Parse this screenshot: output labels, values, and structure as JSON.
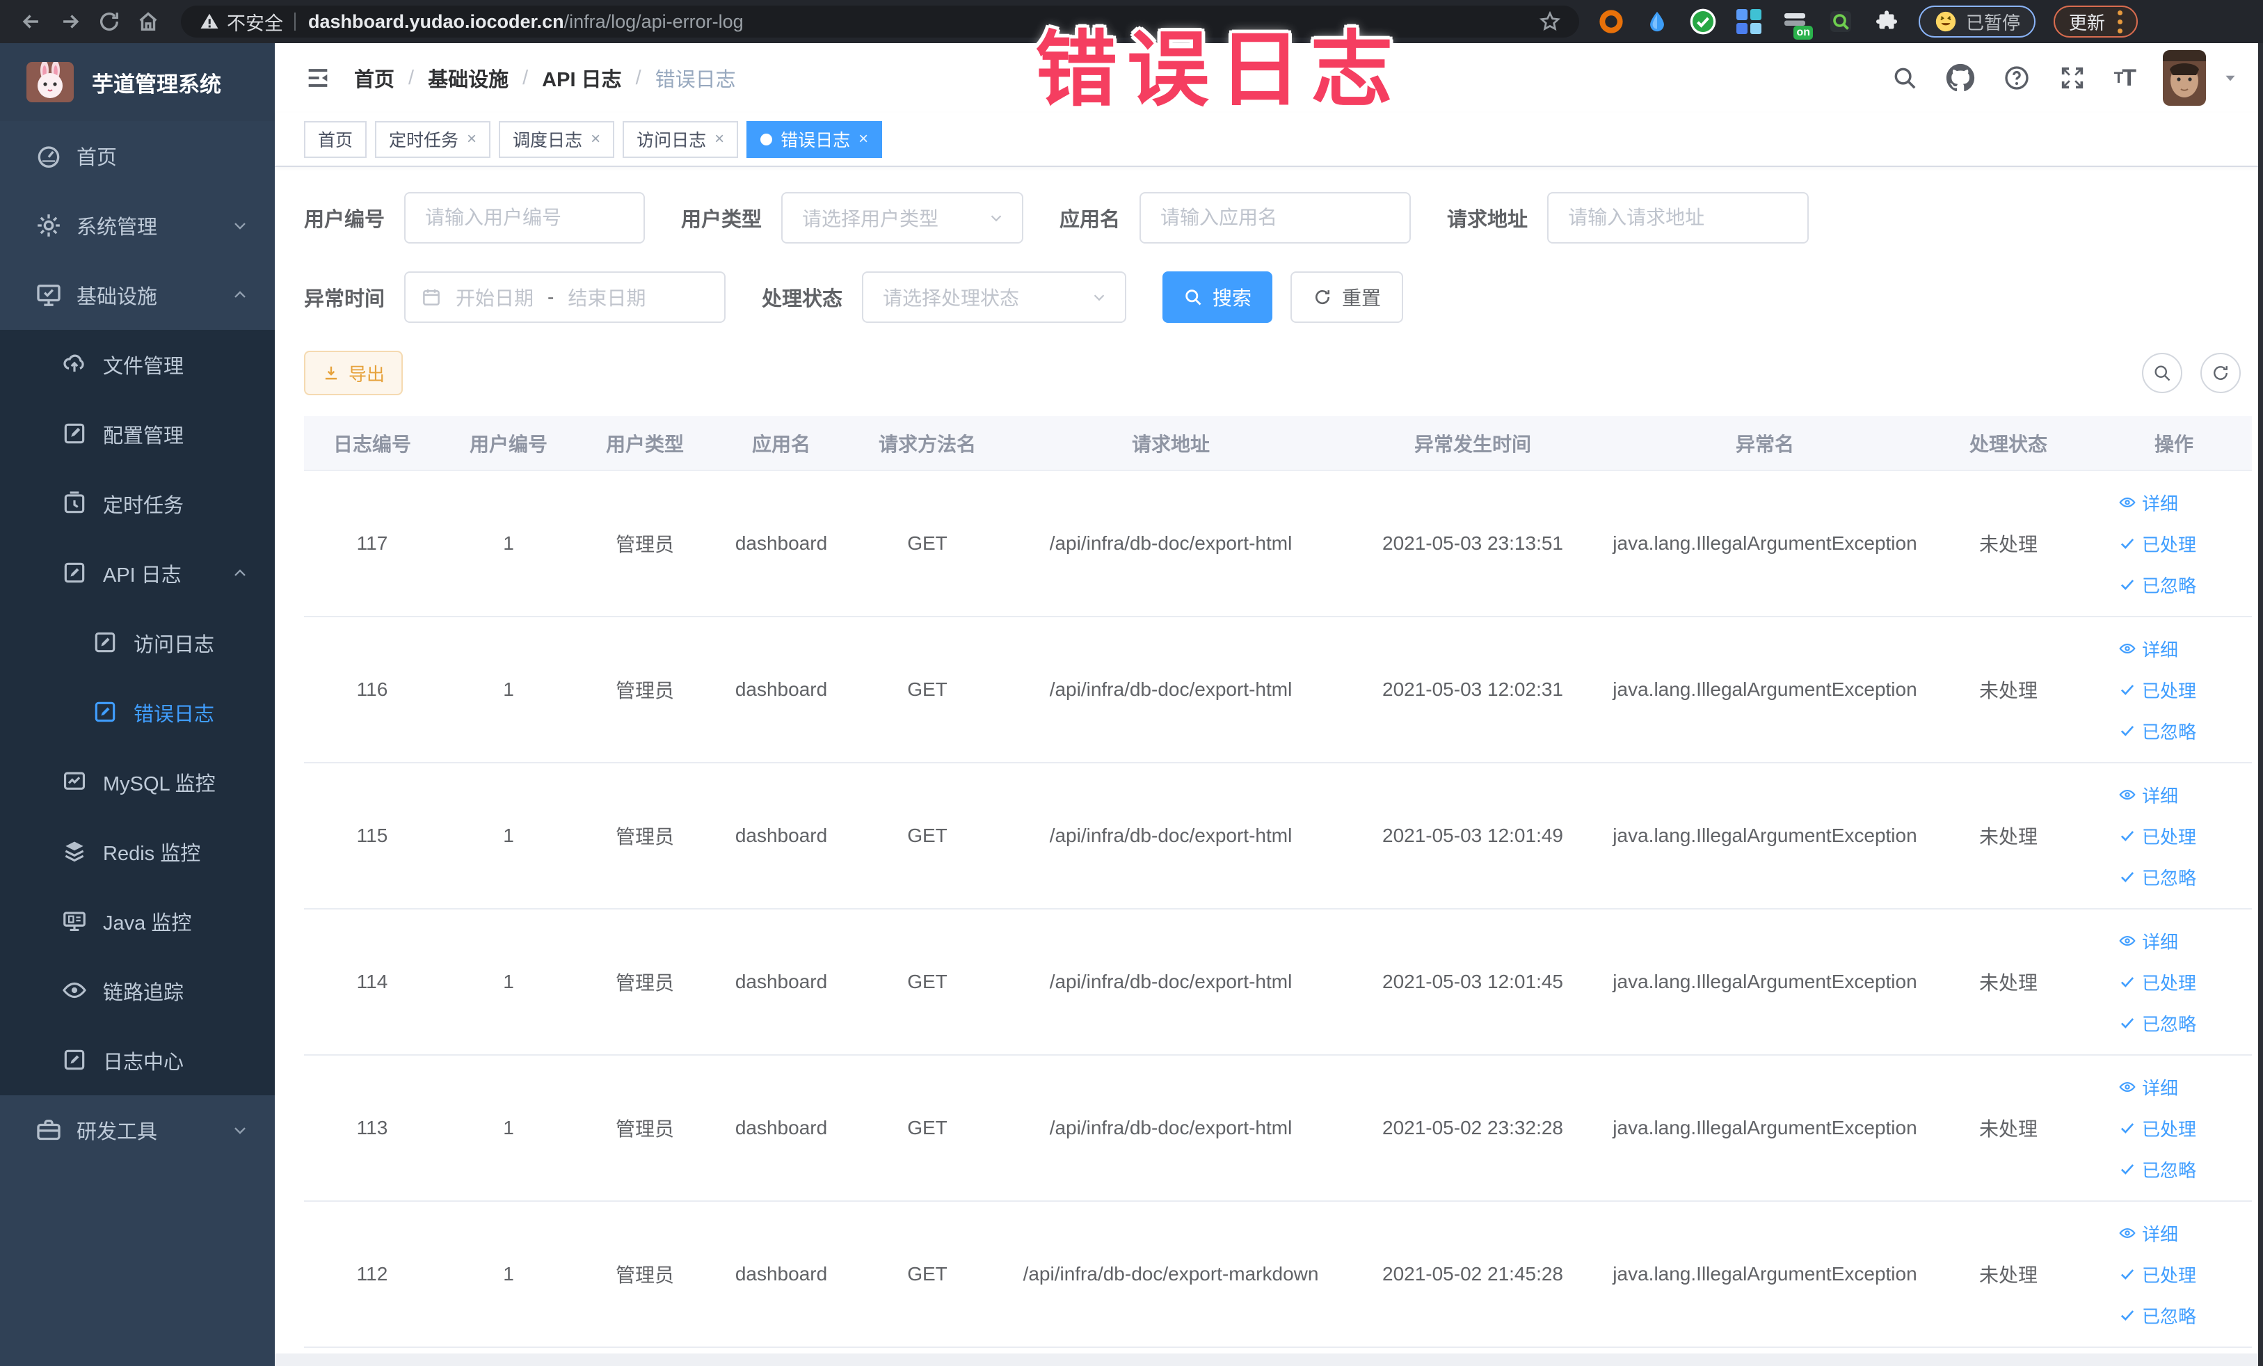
{
  "browser": {
    "security_label": "不安全",
    "url_host": "dashboard.yudao.iocoder.cn",
    "url_path": "/infra/log/api-error-log",
    "paused_label": "已暂停",
    "update_label": "更新"
  },
  "watermark": {
    "text": "错误日志"
  },
  "sidebar": {
    "title": "芋道管理系统",
    "items": [
      {
        "label": "首页"
      },
      {
        "label": "系统管理"
      },
      {
        "label": "基础设施"
      },
      {
        "label": "文件管理"
      },
      {
        "label": "配置管理"
      },
      {
        "label": "定时任务"
      },
      {
        "label": "API 日志"
      },
      {
        "label": "访问日志"
      },
      {
        "label": "错误日志"
      },
      {
        "label": "MySQL 监控"
      },
      {
        "label": "Redis 监控"
      },
      {
        "label": "Java 监控"
      },
      {
        "label": "链路追踪"
      },
      {
        "label": "日志中心"
      },
      {
        "label": "研发工具"
      }
    ]
  },
  "breadcrumb": {
    "items": [
      "首页",
      "基础设施",
      "API 日志",
      "错误日志"
    ],
    "separator": "/"
  },
  "tabs": [
    {
      "label": "首页"
    },
    {
      "label": "定时任务"
    },
    {
      "label": "调度日志"
    },
    {
      "label": "访问日志"
    },
    {
      "label": "错误日志"
    }
  ],
  "filters": {
    "user_id": {
      "label": "用户编号",
      "placeholder": "请输入用户编号"
    },
    "user_type": {
      "label": "用户类型",
      "placeholder": "请选择用户类型"
    },
    "app_name": {
      "label": "应用名",
      "placeholder": "请输入应用名"
    },
    "req_url": {
      "label": "请求地址",
      "placeholder": "请输入请求地址"
    },
    "exc_time": {
      "label": "异常时间",
      "start_placeholder": "开始日期",
      "separator": "-",
      "end_placeholder": "结束日期"
    },
    "status": {
      "label": "处理状态",
      "placeholder": "请选择处理状态"
    },
    "search_label": "搜索",
    "reset_label": "重置"
  },
  "toolbar": {
    "export_label": "导出"
  },
  "table": {
    "columns": [
      "日志编号",
      "用户编号",
      "用户类型",
      "应用名",
      "请求方法名",
      "请求地址",
      "异常发生时间",
      "异常名",
      "处理状态",
      "操作"
    ],
    "action_labels": [
      "详细",
      "已处理",
      "已忽略"
    ],
    "rows": [
      {
        "id": "117",
        "user_id": "1",
        "user_type": "管理员",
        "app": "dashboard",
        "method": "GET",
        "url": "/api/infra/db-doc/export-html",
        "time": "2021-05-03 23:13:51",
        "exception": "java.lang.IllegalArgumentException",
        "status": "未处理"
      },
      {
        "id": "116",
        "user_id": "1",
        "user_type": "管理员",
        "app": "dashboard",
        "method": "GET",
        "url": "/api/infra/db-doc/export-html",
        "time": "2021-05-03 12:02:31",
        "exception": "java.lang.IllegalArgumentException",
        "status": "未处理"
      },
      {
        "id": "115",
        "user_id": "1",
        "user_type": "管理员",
        "app": "dashboard",
        "method": "GET",
        "url": "/api/infra/db-doc/export-html",
        "time": "2021-05-03 12:01:49",
        "exception": "java.lang.IllegalArgumentException",
        "status": "未处理"
      },
      {
        "id": "114",
        "user_id": "1",
        "user_type": "管理员",
        "app": "dashboard",
        "method": "GET",
        "url": "/api/infra/db-doc/export-html",
        "time": "2021-05-03 12:01:45",
        "exception": "java.lang.IllegalArgumentException",
        "status": "未处理"
      },
      {
        "id": "113",
        "user_id": "1",
        "user_type": "管理员",
        "app": "dashboard",
        "method": "GET",
        "url": "/api/infra/db-doc/export-html",
        "time": "2021-05-02 23:32:28",
        "exception": "java.lang.IllegalArgumentException",
        "status": "未处理"
      },
      {
        "id": "112",
        "user_id": "1",
        "user_type": "管理员",
        "app": "dashboard",
        "method": "GET",
        "url": "/api/infra/db-doc/export-markdown",
        "time": "2021-05-02 21:45:28",
        "exception": "java.lang.IllegalArgumentException",
        "status": "未处理"
      }
    ]
  },
  "colors": {
    "accent": "#409eff",
    "warning": "#e6a23c",
    "watermark_pink": "#f53e60",
    "sidebar_bg": "#304156",
    "submenu_bg": "#1f2d3d"
  }
}
